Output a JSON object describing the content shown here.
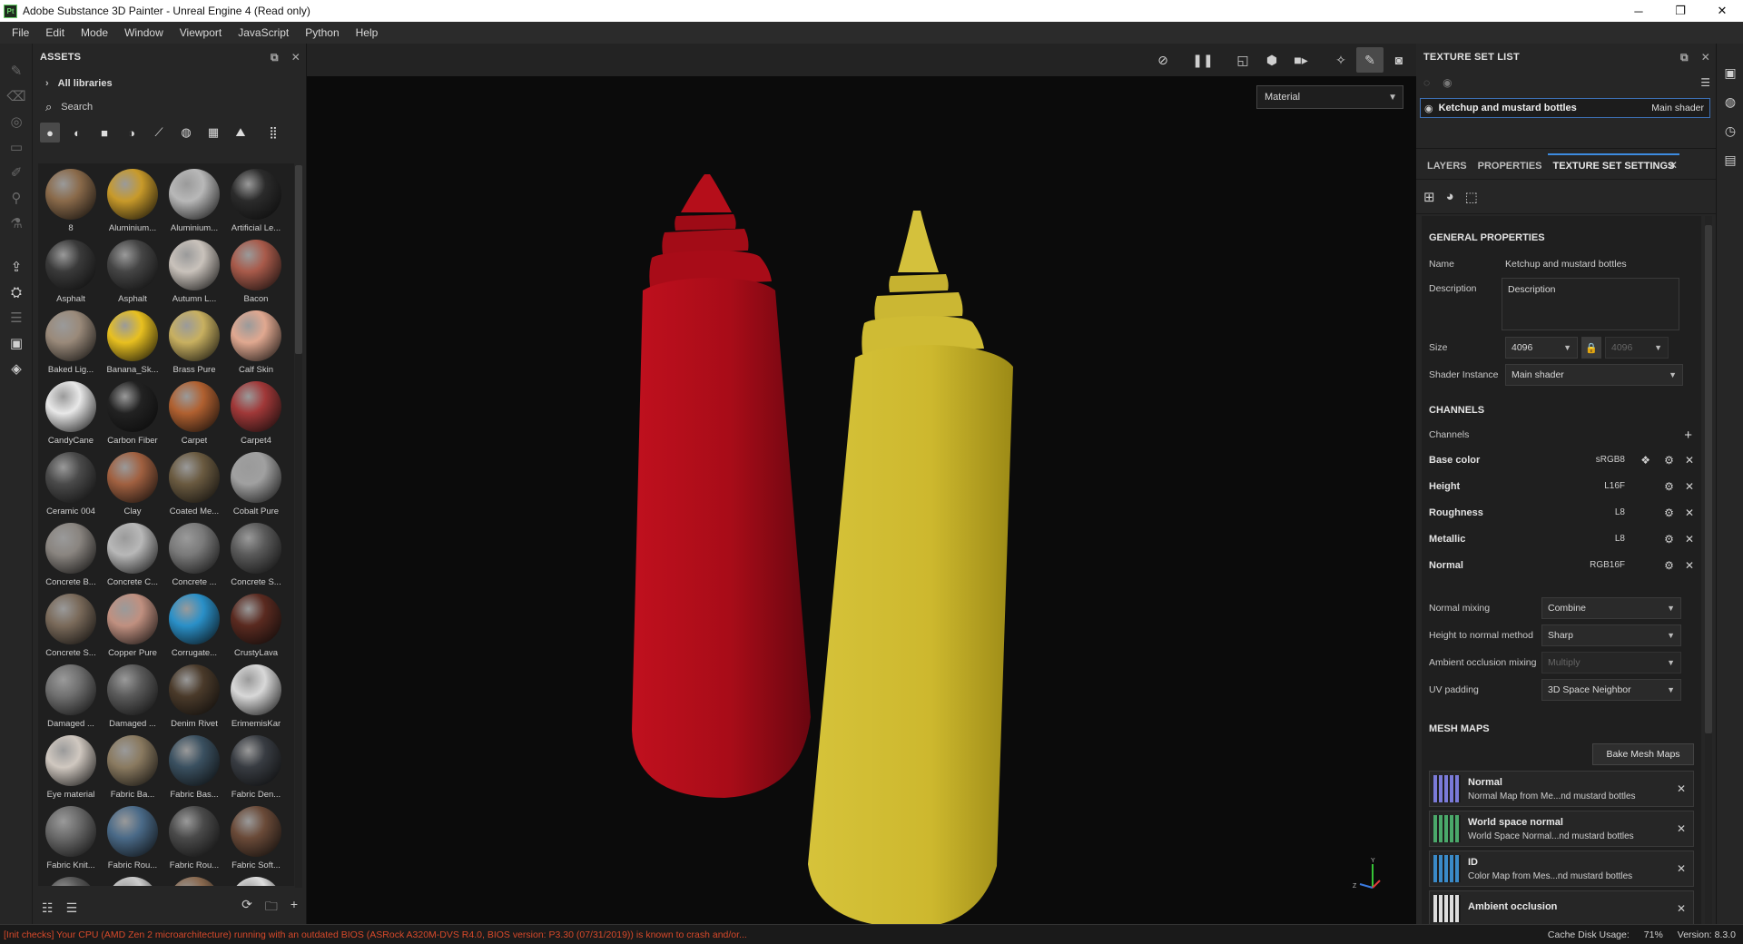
{
  "window": {
    "title": "Adobe Substance 3D Painter - Unreal Engine 4 (Read only)",
    "app_badge": "Pt",
    "controls": [
      "─",
      "❐",
      "✕"
    ]
  },
  "menu": [
    "File",
    "Edit",
    "Mode",
    "Window",
    "Viewport",
    "JavaScript",
    "Python",
    "Help"
  ],
  "assets": {
    "title": "ASSETS",
    "library": "All libraries",
    "search_placeholder": "Search",
    "materials": [
      {
        "label": "8",
        "color": "#8a6a4a"
      },
      {
        "label": "Aluminium...",
        "color": "#c89a2a"
      },
      {
        "label": "Aluminium...",
        "color": "#b8b8b8"
      },
      {
        "label": "Artificial Le...",
        "color": "#2b2b2b"
      },
      {
        "label": "Asphalt",
        "color": "#3a3a3a"
      },
      {
        "label": "Asphalt",
        "color": "#454545"
      },
      {
        "label": "Autumn L...",
        "color": "#c9c2bb"
      },
      {
        "label": "Bacon",
        "color": "#a85a4a"
      },
      {
        "label": "Baked Lig...",
        "color": "#9a8a7a"
      },
      {
        "label": "Banana_Sk...",
        "color": "#e8c020"
      },
      {
        "label": "Brass Pure",
        "color": "#c8b060"
      },
      {
        "label": "Calf Skin",
        "color": "#e0a890"
      },
      {
        "label": "CandyCane",
        "color": "#e8e8e8"
      },
      {
        "label": "Carbon Fiber",
        "color": "#222222"
      },
      {
        "label": "Carpet",
        "color": "#b06030"
      },
      {
        "label": "Carpet4",
        "color": "#a03838"
      },
      {
        "label": "Ceramic 004",
        "color": "#4a4a4a"
      },
      {
        "label": "Clay",
        "color": "#a06040"
      },
      {
        "label": "Coated Me...",
        "color": "#6a5a40"
      },
      {
        "label": "Cobalt Pure",
        "color": "#a0a0a0"
      },
      {
        "label": "Concrete B...",
        "color": "#8a8580"
      },
      {
        "label": "Concrete C...",
        "color": "#b8b8b8"
      },
      {
        "label": "Concrete ...",
        "color": "#7a7a7a"
      },
      {
        "label": "Concrete S...",
        "color": "#5a5a5a"
      },
      {
        "label": "Concrete S...",
        "color": "#7a6a5a"
      },
      {
        "label": "Copper Pure",
        "color": "#c09080"
      },
      {
        "label": "Corrugate...",
        "color": "#2a90c8"
      },
      {
        "label": "CrustyLava",
        "color": "#5a2a20"
      },
      {
        "label": "Damaged ...",
        "color": "#707070"
      },
      {
        "label": "Damaged ...",
        "color": "#5a5a5a"
      },
      {
        "label": "Denim Rivet",
        "color": "#4a3a2a"
      },
      {
        "label": "ErimemisKar",
        "color": "#d8d8d8"
      },
      {
        "label": "Eye material",
        "color": "#d0c8c0"
      },
      {
        "label": "Fabric Ba...",
        "color": "#8a7a60"
      },
      {
        "label": "Fabric Bas...",
        "color": "#3a5060"
      },
      {
        "label": "Fabric Den...",
        "color": "#383c42"
      },
      {
        "label": "Fabric Knit...",
        "color": "#6a6a6a"
      },
      {
        "label": "Fabric Rou...",
        "color": "#4a6a88"
      },
      {
        "label": "Fabric Rou...",
        "color": "#4a4a4a"
      },
      {
        "label": "Fabric Soft...",
        "color": "#6a4a38"
      },
      {
        "label": "",
        "color": "#555555"
      },
      {
        "label": "",
        "color": "#cccccc"
      },
      {
        "label": "",
        "color": "#8a6a50"
      },
      {
        "label": "",
        "color": "#dddddd"
      }
    ]
  },
  "viewport": {
    "channel": "Material"
  },
  "texture_set_list": {
    "title": "TEXTURE SET LIST",
    "item_name": "Ketchup and mustard bottles",
    "item_shader": "Main shader"
  },
  "tabs": [
    "LAYERS",
    "PROPERTIES",
    "TEXTURE SET SETTINGS"
  ],
  "general": {
    "title": "GENERAL PROPERTIES",
    "name_label": "Name",
    "name_value": "Ketchup and mustard bottles",
    "description_label": "Description",
    "description_value": "Description",
    "size_label": "Size",
    "size_value": "4096",
    "size_value2": "4096",
    "shader_label": "Shader Instance",
    "shader_value": "Main shader"
  },
  "channels": {
    "title": "CHANNELS",
    "label": "Channels",
    "items": [
      {
        "name": "Base color",
        "format": "sRGB8"
      },
      {
        "name": "Height",
        "format": "L16F"
      },
      {
        "name": "Roughness",
        "format": "L8"
      },
      {
        "name": "Metallic",
        "format": "L8"
      },
      {
        "name": "Normal",
        "format": "RGB16F"
      }
    ]
  },
  "mixing": [
    {
      "label": "Normal mixing",
      "value": "Combine",
      "disabled": false
    },
    {
      "label": "Height to normal method",
      "value": "Sharp",
      "disabled": false
    },
    {
      "label": "Ambient occlusion mixing",
      "value": "Multiply",
      "disabled": true
    },
    {
      "label": "UV padding",
      "value": "3D Space Neighbor",
      "disabled": false
    }
  ],
  "mesh_maps": {
    "title": "MESH MAPS",
    "bake_label": "Bake Mesh Maps",
    "items": [
      {
        "name": "Normal",
        "desc": "Normal Map from Me...nd mustard bottles",
        "color": "#7a7ad8"
      },
      {
        "name": "World space normal",
        "desc": "World Space Normal...nd mustard bottles",
        "color": "#4aa86a"
      },
      {
        "name": "ID",
        "desc": "Color Map from Mes...nd mustard bottles",
        "color": "#3a8ac8"
      },
      {
        "name": "Ambient occlusion",
        "desc": "",
        "color": "#dddddd"
      }
    ]
  },
  "status": {
    "warning": "[Init checks] Your CPU (AMD Zen 2 microarchitecture) running with an outdated BIOS (ASRock A320M-DVS R4.0, BIOS version: P3.30 (07/31/2019)) is known to crash and/or...",
    "cache": "Cache Disk Usage:",
    "cache_value": "71%",
    "version": "Version: 8.3.0"
  },
  "colors": {
    "accent": "#3d8be0",
    "ketchup": "#b3101c",
    "mustard": "#d9c634",
    "warning": "#d7492a"
  }
}
